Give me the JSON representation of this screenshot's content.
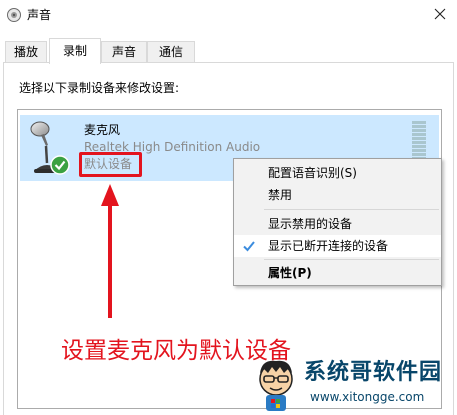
{
  "window": {
    "title": "声音",
    "icon": "speaker-icon"
  },
  "tabs": [
    {
      "label": "播放"
    },
    {
      "label": "录制",
      "active": true
    },
    {
      "label": "声音"
    },
    {
      "label": "通信"
    }
  ],
  "main": {
    "instruction": "选择以下录制设备来修改设置:",
    "device": {
      "name": "麦克风",
      "driver": "Realtek High Definition Audio",
      "status": "默认设备",
      "icon": "microphone-icon",
      "badge": "green-check-icon"
    }
  },
  "context_menu": {
    "items": [
      {
        "label": "配置语音识别(S)"
      },
      {
        "label": "禁用"
      },
      {
        "label": "显示禁用的设备"
      },
      {
        "label": "显示已断开连接的设备",
        "checked": true
      },
      {
        "label": "属性(P)",
        "bold": true
      }
    ]
  },
  "annotation": {
    "caption": "设置麦克风为默认设备",
    "color": "#e3141e"
  },
  "watermark": {
    "title": "系统哥软件园",
    "url": "www.xitongge.com"
  },
  "colors": {
    "selection": "#cce8ff",
    "accent": "#3c8cde",
    "annotation": "#e3141e",
    "watermark": "#08466a"
  }
}
